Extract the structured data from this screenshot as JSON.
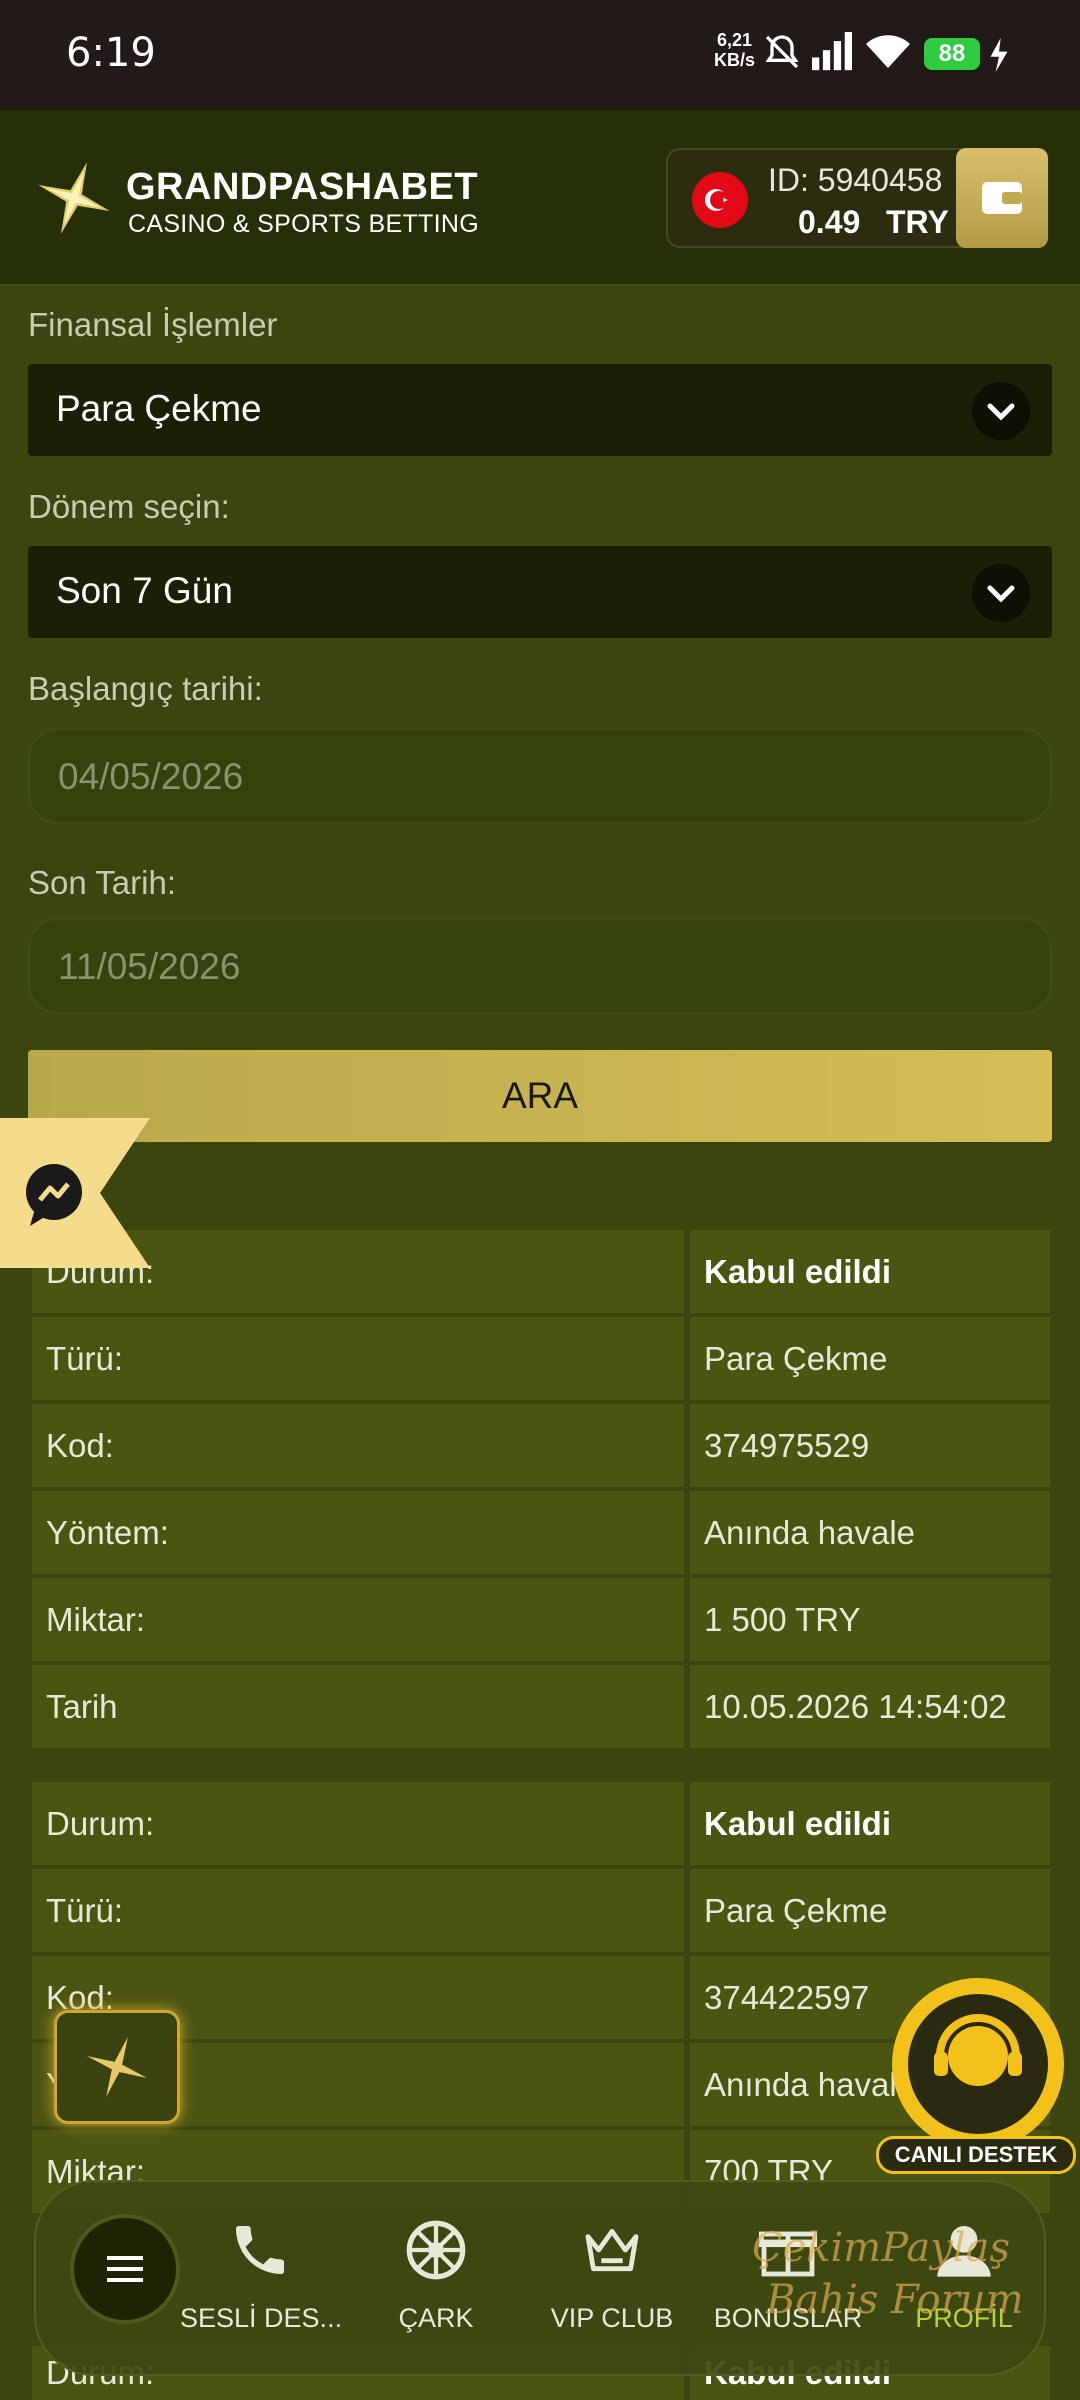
{
  "status_bar": {
    "time": "6:19",
    "net_speed_value": "6,21",
    "net_speed_unit": "KB/s",
    "battery": "88"
  },
  "header": {
    "brand_name": "GRANDPASHABET",
    "brand_sub": "CASINO & SPORTS BETTING",
    "account_id": "ID: 5940458",
    "balance": "0.49",
    "currency": "TRY"
  },
  "form": {
    "finance_label": "Finansal İşlemler",
    "finance_value": "Para Çekme",
    "period_label": "Dönem seçin:",
    "period_value": "Son 7 Gün",
    "start_label": "Başlangıç tarihi:",
    "start_value": "04/05/2026",
    "end_label": "Son Tarih:",
    "end_value": "11/05/2026",
    "search_button": "ARA"
  },
  "transactions": [
    {
      "rows": [
        {
          "key": "Durum:",
          "value": "Kabul edildi"
        },
        {
          "key": "Türü:",
          "value": "Para Çekme"
        },
        {
          "key": "Kod:",
          "value": "374975529"
        },
        {
          "key": "Yöntem:",
          "value": "Anında havale"
        },
        {
          "key": "Miktar:",
          "value": "1 500 TRY"
        },
        {
          "key": "Tarih",
          "value": "10.05.2026 14:54:02"
        }
      ]
    },
    {
      "rows": [
        {
          "key": "Durum:",
          "value": "Kabul edildi"
        },
        {
          "key": "Türü:",
          "value": "Para Çekme"
        },
        {
          "key": "Kod:",
          "value": "374422597"
        },
        {
          "key": "Y",
          "value": "Anında havale"
        },
        {
          "key": "Miktar:",
          "value": "700 TRY"
        }
      ]
    },
    {
      "rows": [
        {
          "key": "Durum:",
          "value": "Kabul edildi"
        }
      ]
    }
  ],
  "live_support_label": "CANLI DESTEK",
  "bottom_nav": {
    "items": [
      {
        "label": "SESLİ DES..."
      },
      {
        "label": "ÇARK"
      },
      {
        "label": "VIP CLUB"
      },
      {
        "label": "BONUSLAR"
      },
      {
        "label": "PROFİL"
      }
    ]
  },
  "watermark": {
    "line1": "ÇekimPaylaş",
    "line2": "Bahis Forum"
  },
  "colors": {
    "accent_gold": "#d6bd56",
    "background": "#3a4510",
    "active_nav": "#b9d13a"
  }
}
